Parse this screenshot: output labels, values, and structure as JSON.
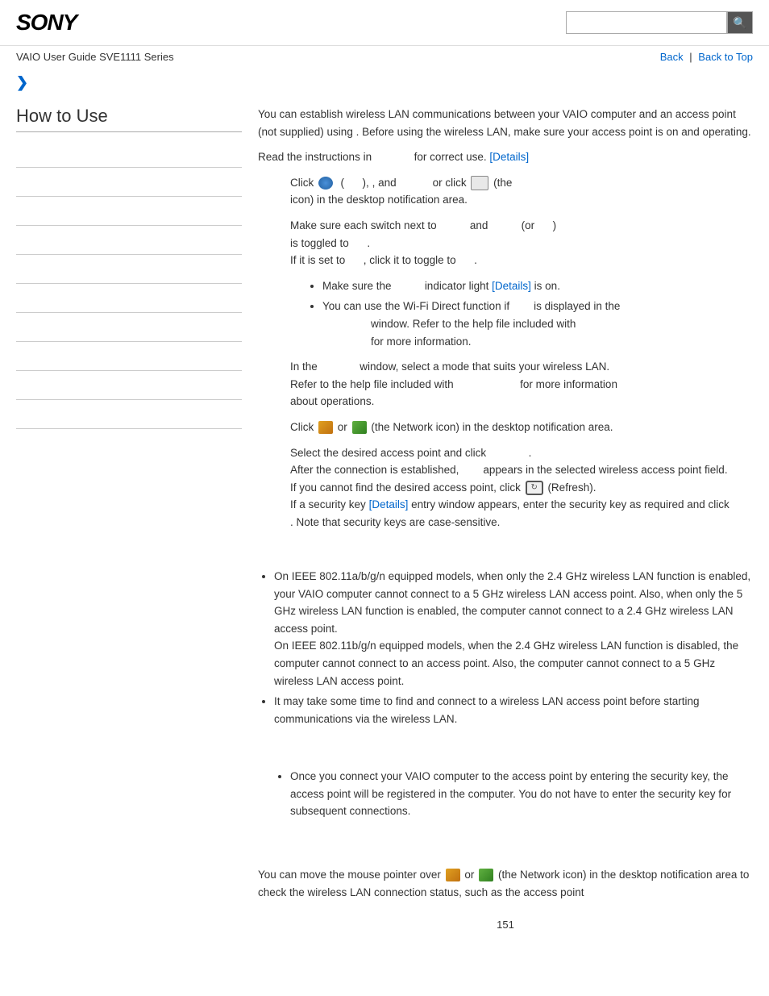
{
  "header": {
    "logo": "SONY",
    "search_placeholder": "",
    "search_icon": "🔍"
  },
  "nav": {
    "guide_label": "VAIO User Guide SVE1111 Series",
    "back_label": "Back",
    "separator": "|",
    "back_to_top_label": "Back to Top"
  },
  "breadcrumb": {
    "chevron": "❯"
  },
  "sidebar": {
    "title": "How to Use",
    "items": [
      "",
      "",
      "",
      "",
      "",
      "",
      "",
      "",
      "",
      ""
    ]
  },
  "content": {
    "para1": "You can establish wireless LAN communications between your VAIO computer and an access point (not supplied) using",
    "para1b": ". Before using the wireless LAN, make sure your access point is on and operating.",
    "para2": "Read the instructions in",
    "para2b": "for correct use.",
    "details1": "[Details]",
    "step1_prefix": "Click",
    "step1_mid": "(        ),",
    "step1_and": ", and",
    "step1_or": "or click",
    "step1_suffix": "(the",
    "step1_end": "icon) in the desktop notification area.",
    "step2_prefix": "Make sure each switch next to",
    "step2_and": "and",
    "step2_or": "(or",
    "step2_suffix": ")",
    "step2_toggled": "is toggled to",
    "step2_toggled2": ".",
    "step2_if": "If it is set to",
    "step2_click": ", click it to toggle to",
    "step2_final": ".",
    "bullet1": "Make sure the",
    "bullet1_mid": "indicator light",
    "bullet1_details": "[Details]",
    "bullet1_suffix": "is on.",
    "bullet2": "You can use the Wi-Fi Direct function if",
    "bullet2_mid": "is displayed in the",
    "bullet2_window": "window. Refer to the help file included with",
    "bullet2_suffix": "for more information.",
    "step3_prefix": "In the",
    "step3_mid": "window, select a mode that suits your wireless LAN.",
    "step3_refer": "Refer to the help file included with",
    "step3_refer_mid": "for more information",
    "step3_about": "about operations.",
    "step4": "Click",
    "step4_mid": "or",
    "step4_suffix": "(the Network icon) in the desktop notification area.",
    "step5": "Select the desired access point and click",
    "step5_suffix": ".",
    "step6_prefix": "After the connection is established,",
    "step6_mid": "appears in the selected wireless access point field.",
    "step7_prefix": "If you cannot find the desired access point, click",
    "step7_suffix": "(Refresh).",
    "step8_prefix": "If a security key",
    "step8_details": "[Details]",
    "step8_mid": "entry window appears, enter the security key as required and click",
    "step8_suffix": ". Note that security keys are case-sensitive.",
    "note_title": "",
    "note_items": [
      "On IEEE 802.11a/b/g/n equipped models, when only the 2.4 GHz wireless LAN function is enabled, your VAIO computer cannot connect to a 5 GHz wireless LAN access point. Also, when only the 5 GHz wireless LAN function is enabled, the computer cannot connect to a 2.4 GHz wireless LAN access point.\nOn IEEE 802.11b/g/n equipped models, when the 2.4 GHz wireless LAN function is disabled, the computer cannot connect to an access point. Also, the computer cannot connect to a 5 GHz wireless LAN access point.",
      "It may take some time to find and connect to a wireless LAN access point before starting communications via the wireless LAN."
    ],
    "hint_title": "",
    "hint_items": [
      "Once you connect your VAIO computer to the access point by entering the security key, the access point will be registered in the computer. You do not have to enter the security key for subsequent connections."
    ],
    "footer_para1": "You can move the mouse pointer over",
    "footer_para1_or": "or",
    "footer_para1_suffix": "(the Network icon) in the desktop notification area to check the wireless LAN connection status, such as the access point",
    "page_number": "151"
  }
}
